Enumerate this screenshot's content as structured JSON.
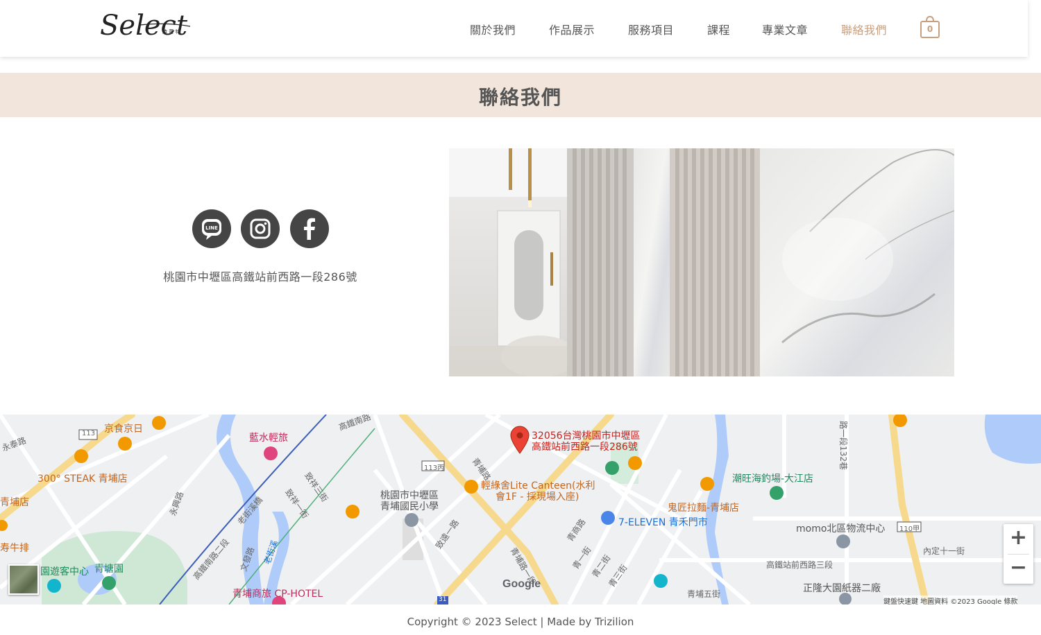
{
  "header": {
    "logo_text": "Select",
    "logo_sub": "詩 蕾 特",
    "nav": [
      {
        "label": "關於我們",
        "active": false
      },
      {
        "label": "作品展示",
        "active": false
      },
      {
        "label": "服務項目",
        "active": false
      },
      {
        "label": "課程",
        "active": false
      },
      {
        "label": "專業文章",
        "active": false
      },
      {
        "label": "聯絡我們",
        "active": true
      }
    ],
    "cart_count": "0",
    "accent_color": "#c9a07e"
  },
  "page_title": "聯絡我們",
  "contact": {
    "social": [
      {
        "name": "LINE",
        "icon": "line-icon"
      },
      {
        "name": "Instagram",
        "icon": "instagram-icon"
      },
      {
        "name": "Facebook",
        "icon": "facebook-icon"
      }
    ],
    "line_badge": "LINE",
    "address": "桃園市中壢區高鐵站前西路一段286號"
  },
  "map": {
    "marker_label_line1": "32056台灣桃園市中壢區",
    "marker_label_line2": "高鐵站前西路一段286號",
    "places": {
      "jingshi": "京食京日",
      "steak": "300° STEAK 青埔店",
      "qingpu_store": "青埔店",
      "niupai": "寿牛排",
      "lanshui": "藍水輕旅",
      "visitor": "園遊客中心",
      "qingtang": "青塘園",
      "cp_hotel": "青埔商旅 CP-HOTEL",
      "school_l1": "桃園市中壢區",
      "school_l2": "青埔國民小學",
      "lite_l1": "輕綠舍Lite Canteen(水利",
      "lite_l2": "會1F - 採現場入座)",
      "seven": "7-ELEVEN 青禾門市",
      "ramen": "鬼匠拉麵-青埔店",
      "fishing": "潮旺海釣場-大江店",
      "momo": "momo北區物流中心",
      "zhenglong": "正隆大園紙器二廠"
    },
    "roads": {
      "r113": "113",
      "r113c": "113丙",
      "r110a": "110甲",
      "r31": "31",
      "yongtai": "永泰路",
      "gaotie_south": "高鐵南路",
      "gaotie_south2": "高鐵南路二段",
      "laojie_bridge": "老街溪橋",
      "laojie_river": "老街溪",
      "zhixiang3": "致祥三街",
      "zhixiang1": "致祥一街",
      "zhiyuan1": "致遠一路",
      "qingpu_rd": "青埔路",
      "qingshang": "青商路",
      "qingpu1": "青埔路一段",
      "qing1": "青一街",
      "qing2": "青二街",
      "qing3": "青三街",
      "qingpu5": "青埔五街",
      "gaotie_west3": "高鐵站前西路三段",
      "neiding11": "內定十一街",
      "road132": "路一段132巷",
      "yongxing": "永興路",
      "wenfa": "文發路"
    },
    "google": "Google",
    "attribution": "鍵盤快速鍵   地圖資料 ©2023 Google   條款",
    "zoom_in": "+",
    "zoom_out": "−"
  },
  "footer": {
    "copyright": "Copyright © 2023 Select | Made by Trizilion"
  }
}
